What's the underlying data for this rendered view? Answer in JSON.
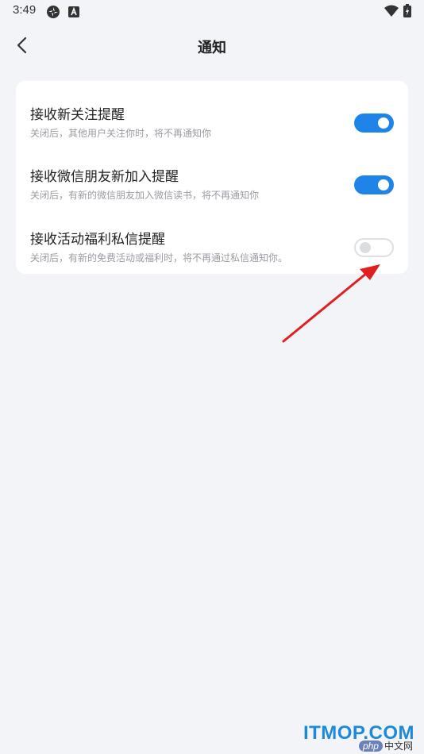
{
  "status_bar": {
    "time": "3:49",
    "icons": [
      "app-icon",
      "a-badge-icon",
      "wifi-icon",
      "battery-icon"
    ]
  },
  "header": {
    "title": "通知",
    "back_icon": "chevron-left-icon"
  },
  "settings": [
    {
      "title": "接收新关注提醒",
      "description": "关闭后，其他用户关注你时，将不再通知你",
      "enabled": true
    },
    {
      "title": "接收微信朋友新加入提醒",
      "description": "关闭后，有新的微信朋友加入微信读书，将不再通知你",
      "enabled": true
    },
    {
      "title": "接收活动福利私信提醒",
      "description": "关闭后，有新的免费活动或福利时，将不再通过私信通知你。",
      "enabled": false
    }
  ],
  "colors": {
    "accent": "#1f84e8",
    "background": "#f3f4f7",
    "card": "#ffffff",
    "annotation": "#e02020"
  },
  "watermark": {
    "main": "ITMOP.COM",
    "php_badge": "php",
    "php_text": "中文网"
  }
}
